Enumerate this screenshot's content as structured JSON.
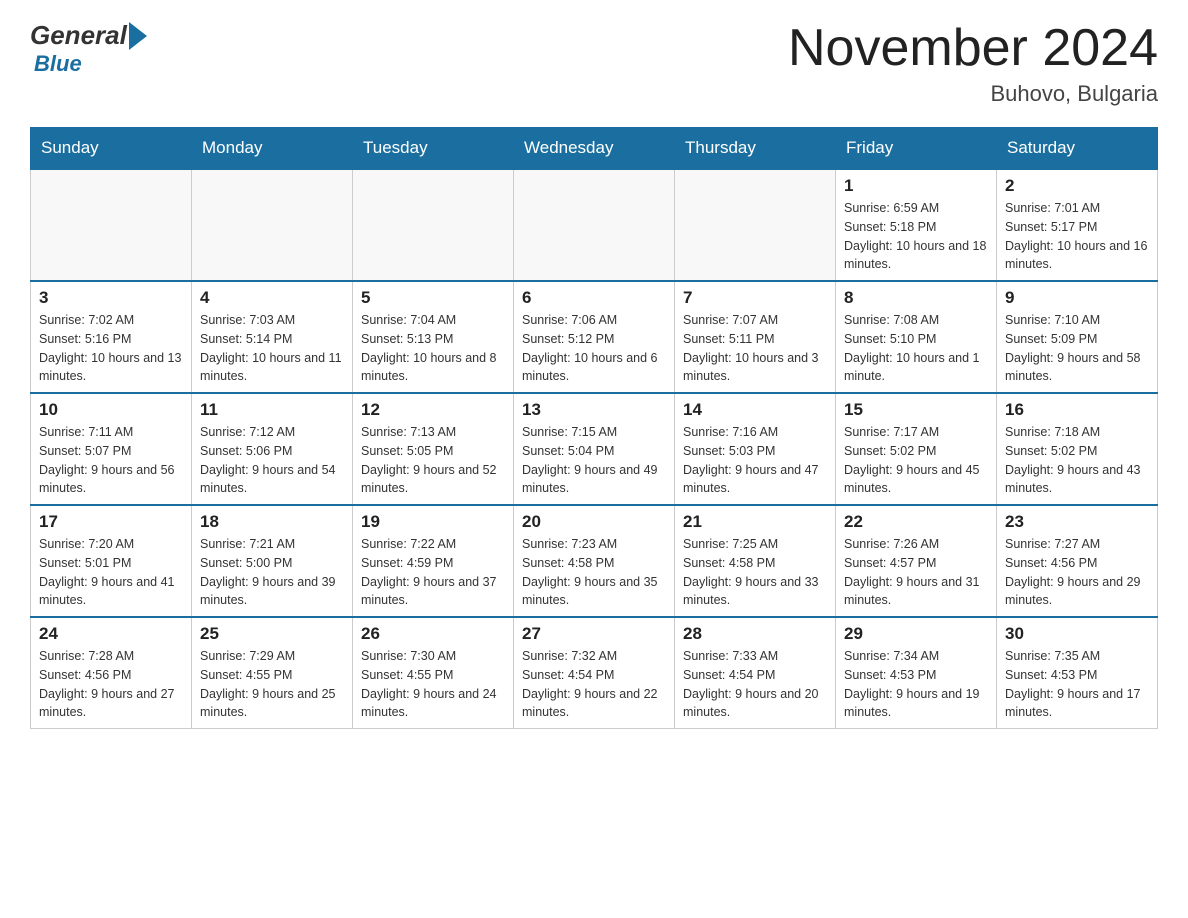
{
  "header": {
    "logo_general": "General",
    "logo_blue": "Blue",
    "month_title": "November 2024",
    "location": "Buhovo, Bulgaria"
  },
  "days_of_week": [
    "Sunday",
    "Monday",
    "Tuesday",
    "Wednesday",
    "Thursday",
    "Friday",
    "Saturday"
  ],
  "weeks": [
    [
      {
        "day": "",
        "sunrise": "",
        "sunset": "",
        "daylight": ""
      },
      {
        "day": "",
        "sunrise": "",
        "sunset": "",
        "daylight": ""
      },
      {
        "day": "",
        "sunrise": "",
        "sunset": "",
        "daylight": ""
      },
      {
        "day": "",
        "sunrise": "",
        "sunset": "",
        "daylight": ""
      },
      {
        "day": "",
        "sunrise": "",
        "sunset": "",
        "daylight": ""
      },
      {
        "day": "1",
        "sunrise": "Sunrise: 6:59 AM",
        "sunset": "Sunset: 5:18 PM",
        "daylight": "Daylight: 10 hours and 18 minutes."
      },
      {
        "day": "2",
        "sunrise": "Sunrise: 7:01 AM",
        "sunset": "Sunset: 5:17 PM",
        "daylight": "Daylight: 10 hours and 16 minutes."
      }
    ],
    [
      {
        "day": "3",
        "sunrise": "Sunrise: 7:02 AM",
        "sunset": "Sunset: 5:16 PM",
        "daylight": "Daylight: 10 hours and 13 minutes."
      },
      {
        "day": "4",
        "sunrise": "Sunrise: 7:03 AM",
        "sunset": "Sunset: 5:14 PM",
        "daylight": "Daylight: 10 hours and 11 minutes."
      },
      {
        "day": "5",
        "sunrise": "Sunrise: 7:04 AM",
        "sunset": "Sunset: 5:13 PM",
        "daylight": "Daylight: 10 hours and 8 minutes."
      },
      {
        "day": "6",
        "sunrise": "Sunrise: 7:06 AM",
        "sunset": "Sunset: 5:12 PM",
        "daylight": "Daylight: 10 hours and 6 minutes."
      },
      {
        "day": "7",
        "sunrise": "Sunrise: 7:07 AM",
        "sunset": "Sunset: 5:11 PM",
        "daylight": "Daylight: 10 hours and 3 minutes."
      },
      {
        "day": "8",
        "sunrise": "Sunrise: 7:08 AM",
        "sunset": "Sunset: 5:10 PM",
        "daylight": "Daylight: 10 hours and 1 minute."
      },
      {
        "day": "9",
        "sunrise": "Sunrise: 7:10 AM",
        "sunset": "Sunset: 5:09 PM",
        "daylight": "Daylight: 9 hours and 58 minutes."
      }
    ],
    [
      {
        "day": "10",
        "sunrise": "Sunrise: 7:11 AM",
        "sunset": "Sunset: 5:07 PM",
        "daylight": "Daylight: 9 hours and 56 minutes."
      },
      {
        "day": "11",
        "sunrise": "Sunrise: 7:12 AM",
        "sunset": "Sunset: 5:06 PM",
        "daylight": "Daylight: 9 hours and 54 minutes."
      },
      {
        "day": "12",
        "sunrise": "Sunrise: 7:13 AM",
        "sunset": "Sunset: 5:05 PM",
        "daylight": "Daylight: 9 hours and 52 minutes."
      },
      {
        "day": "13",
        "sunrise": "Sunrise: 7:15 AM",
        "sunset": "Sunset: 5:04 PM",
        "daylight": "Daylight: 9 hours and 49 minutes."
      },
      {
        "day": "14",
        "sunrise": "Sunrise: 7:16 AM",
        "sunset": "Sunset: 5:03 PM",
        "daylight": "Daylight: 9 hours and 47 minutes."
      },
      {
        "day": "15",
        "sunrise": "Sunrise: 7:17 AM",
        "sunset": "Sunset: 5:02 PM",
        "daylight": "Daylight: 9 hours and 45 minutes."
      },
      {
        "day": "16",
        "sunrise": "Sunrise: 7:18 AM",
        "sunset": "Sunset: 5:02 PM",
        "daylight": "Daylight: 9 hours and 43 minutes."
      }
    ],
    [
      {
        "day": "17",
        "sunrise": "Sunrise: 7:20 AM",
        "sunset": "Sunset: 5:01 PM",
        "daylight": "Daylight: 9 hours and 41 minutes."
      },
      {
        "day": "18",
        "sunrise": "Sunrise: 7:21 AM",
        "sunset": "Sunset: 5:00 PM",
        "daylight": "Daylight: 9 hours and 39 minutes."
      },
      {
        "day": "19",
        "sunrise": "Sunrise: 7:22 AM",
        "sunset": "Sunset: 4:59 PM",
        "daylight": "Daylight: 9 hours and 37 minutes."
      },
      {
        "day": "20",
        "sunrise": "Sunrise: 7:23 AM",
        "sunset": "Sunset: 4:58 PM",
        "daylight": "Daylight: 9 hours and 35 minutes."
      },
      {
        "day": "21",
        "sunrise": "Sunrise: 7:25 AM",
        "sunset": "Sunset: 4:58 PM",
        "daylight": "Daylight: 9 hours and 33 minutes."
      },
      {
        "day": "22",
        "sunrise": "Sunrise: 7:26 AM",
        "sunset": "Sunset: 4:57 PM",
        "daylight": "Daylight: 9 hours and 31 minutes."
      },
      {
        "day": "23",
        "sunrise": "Sunrise: 7:27 AM",
        "sunset": "Sunset: 4:56 PM",
        "daylight": "Daylight: 9 hours and 29 minutes."
      }
    ],
    [
      {
        "day": "24",
        "sunrise": "Sunrise: 7:28 AM",
        "sunset": "Sunset: 4:56 PM",
        "daylight": "Daylight: 9 hours and 27 minutes."
      },
      {
        "day": "25",
        "sunrise": "Sunrise: 7:29 AM",
        "sunset": "Sunset: 4:55 PM",
        "daylight": "Daylight: 9 hours and 25 minutes."
      },
      {
        "day": "26",
        "sunrise": "Sunrise: 7:30 AM",
        "sunset": "Sunset: 4:55 PM",
        "daylight": "Daylight: 9 hours and 24 minutes."
      },
      {
        "day": "27",
        "sunrise": "Sunrise: 7:32 AM",
        "sunset": "Sunset: 4:54 PM",
        "daylight": "Daylight: 9 hours and 22 minutes."
      },
      {
        "day": "28",
        "sunrise": "Sunrise: 7:33 AM",
        "sunset": "Sunset: 4:54 PM",
        "daylight": "Daylight: 9 hours and 20 minutes."
      },
      {
        "day": "29",
        "sunrise": "Sunrise: 7:34 AM",
        "sunset": "Sunset: 4:53 PM",
        "daylight": "Daylight: 9 hours and 19 minutes."
      },
      {
        "day": "30",
        "sunrise": "Sunrise: 7:35 AM",
        "sunset": "Sunset: 4:53 PM",
        "daylight": "Daylight: 9 hours and 17 minutes."
      }
    ]
  ]
}
